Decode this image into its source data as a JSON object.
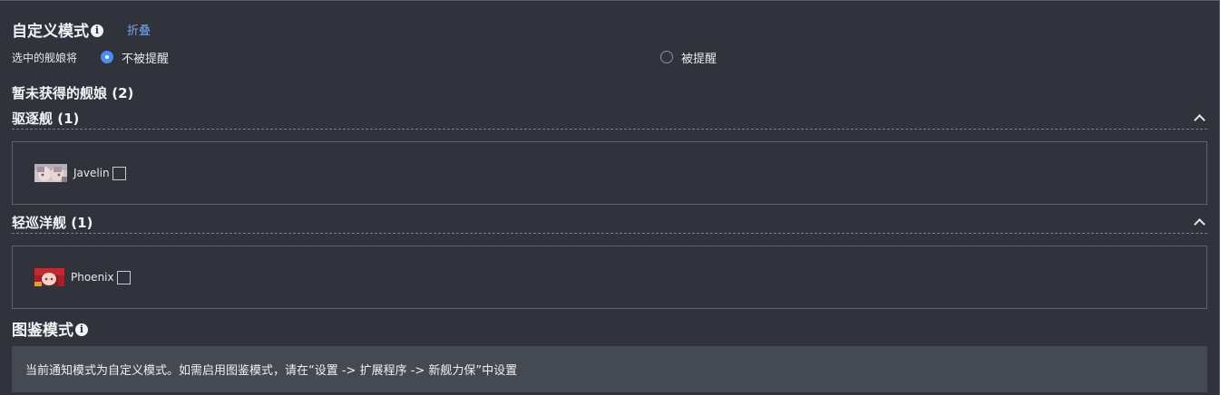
{
  "custom_mode": {
    "title": "自定义模式",
    "info_glyph": "i",
    "collapse_label": "折叠"
  },
  "selection": {
    "label": "选中的舰娘将",
    "options": [
      {
        "label": "不被提醒",
        "checked": true
      },
      {
        "label": "被提醒",
        "checked": false
      }
    ]
  },
  "unacquired": {
    "title": "暂未获得的舰娘 (2)",
    "categories": [
      {
        "title": "驱逐舰 (1)",
        "ships": [
          {
            "name": "Javelin",
            "checked": false,
            "avatar_icon": "javelin-portrait"
          }
        ]
      },
      {
        "title": "轻巡洋舰 (1)",
        "ships": [
          {
            "name": "Phoenix",
            "checked": false,
            "avatar_icon": "phoenix-portrait"
          }
        ]
      }
    ]
  },
  "dex_mode": {
    "title": "图鉴模式",
    "info_glyph": "i",
    "notice": "当前通知模式为自定义模式。如需启用图鉴模式，请在“设置 -> 扩展程序 -> 新舰力保”中设置"
  },
  "colors": {
    "background": "#30333c",
    "accent": "#4a8ff0",
    "link": "#7ba7e6",
    "notice_bg": "#454952"
  }
}
